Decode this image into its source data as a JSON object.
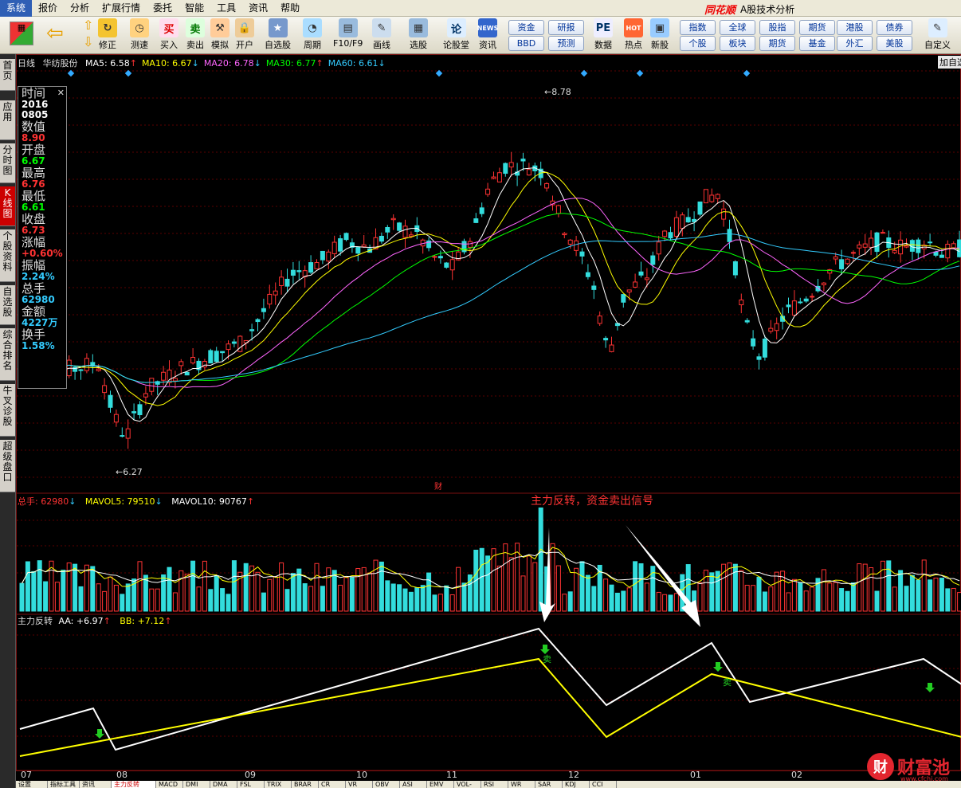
{
  "menu": [
    "系统",
    "报价",
    "分析",
    "扩展行情",
    "委托",
    "智能",
    "工具",
    "资讯",
    "帮助"
  ],
  "brand": {
    "logo": "同花顺",
    "title": "A股技术分析"
  },
  "toolbar": {
    "left": [
      "修正",
      "测速",
      "买入",
      "卖出",
      "模拟",
      "开户",
      "自选股",
      "周期",
      "F10/F9",
      "画线",
      "选股",
      "论股堂",
      "资讯",
      "数据",
      "热点",
      "新股",
      "自定义"
    ],
    "quick": [
      "资金",
      "研报",
      "BBD",
      "预测",
      "指数",
      "全球",
      "股指",
      "期货",
      "港股",
      "债券",
      "个股",
      "板块",
      "期货",
      "基金",
      "外汇",
      "美股"
    ],
    "icon_text": {
      "buy": "买",
      "sell": "卖",
      "news": "NEWS",
      "pe": "PE",
      "hot": "HOT",
      "lun": "论"
    }
  },
  "sidebar": [
    "首页",
    "应用",
    "分时图",
    "K线图",
    "个股资料",
    "自选股",
    "综合排名",
    "牛叉诊股",
    "超级盘口"
  ],
  "kline": {
    "period": "日线",
    "stock": "华纺股份",
    "ma": [
      {
        "n": "MA5: 6.58",
        "arrow": "↑",
        "color": "#ffffff"
      },
      {
        "n": "MA10: 6.67",
        "arrow": "↓",
        "color": "#ffff00"
      },
      {
        "n": "MA20: 6.78",
        "arrow": "↓",
        "color": "#ff66ff"
      },
      {
        "n": "MA30: 6.77",
        "arrow": "↑",
        "color": "#00ff00"
      },
      {
        "n": "MA60: 6.61",
        "arrow": "↓",
        "color": "#33ccff"
      }
    ],
    "high_label": "8.78",
    "low_label": "6.27",
    "add_label": "加自选",
    "fin_marker": "财"
  },
  "info": [
    {
      "k": "时间",
      "v": "2016",
      "c": "#ffffff"
    },
    {
      "k": "",
      "v": "0805",
      "c": "#ffffff"
    },
    {
      "k": "数值",
      "v": "8.90",
      "c": "#ff3333"
    },
    {
      "k": "开盘",
      "v": "6.67",
      "c": "#00ff00"
    },
    {
      "k": "最高",
      "v": "6.76",
      "c": "#ff3333"
    },
    {
      "k": "最低",
      "v": "6.61",
      "c": "#00ff00"
    },
    {
      "k": "收盘",
      "v": "6.73",
      "c": "#ff3333"
    },
    {
      "k": "涨幅",
      "v": "+0.60%",
      "c": "#ff3333"
    },
    {
      "k": "振幅",
      "v": "2.24%",
      "c": "#33ccff"
    },
    {
      "k": "总手",
      "v": "62980",
      "c": "#33ccff"
    },
    {
      "k": "金额",
      "v": "4227万",
      "c": "#33ccff"
    },
    {
      "k": "换手",
      "v": "1.58%",
      "c": "#33ccff"
    }
  ],
  "volume": {
    "total": "总手: 62980",
    "total_arrow": "↓",
    "mavol5": "MAVOL5: 79510",
    "mavol5_arrow": "↓",
    "mavol10": "MAVOL10: 90767",
    "mavol10_arrow": "↑",
    "annotation": "主力反转，资金卖出信号"
  },
  "indicator": {
    "name": "主力反转",
    "aa": "AA: +6.97",
    "aa_arrow": "↑",
    "bb": "BB: +7.12",
    "bb_arrow": "↑",
    "sell_label": "卖"
  },
  "dates": [
    "07",
    "08",
    "09",
    "10",
    "11",
    "12",
    "01",
    "02"
  ],
  "tabs": [
    "设置",
    "指标工具",
    "资讯",
    "主力反转",
    "MACD",
    "DMI",
    "DMA",
    "FSL",
    "TRIX",
    "BRAR",
    "CR",
    "VR",
    "OBV",
    "ASI",
    "EMV",
    "VOL-TDX",
    "RSI",
    "WR",
    "SAR",
    "KDJ",
    "CCI"
  ],
  "watermark": {
    "name": "财富池",
    "url": "www.cfchi.com",
    "icon": "财"
  }
}
